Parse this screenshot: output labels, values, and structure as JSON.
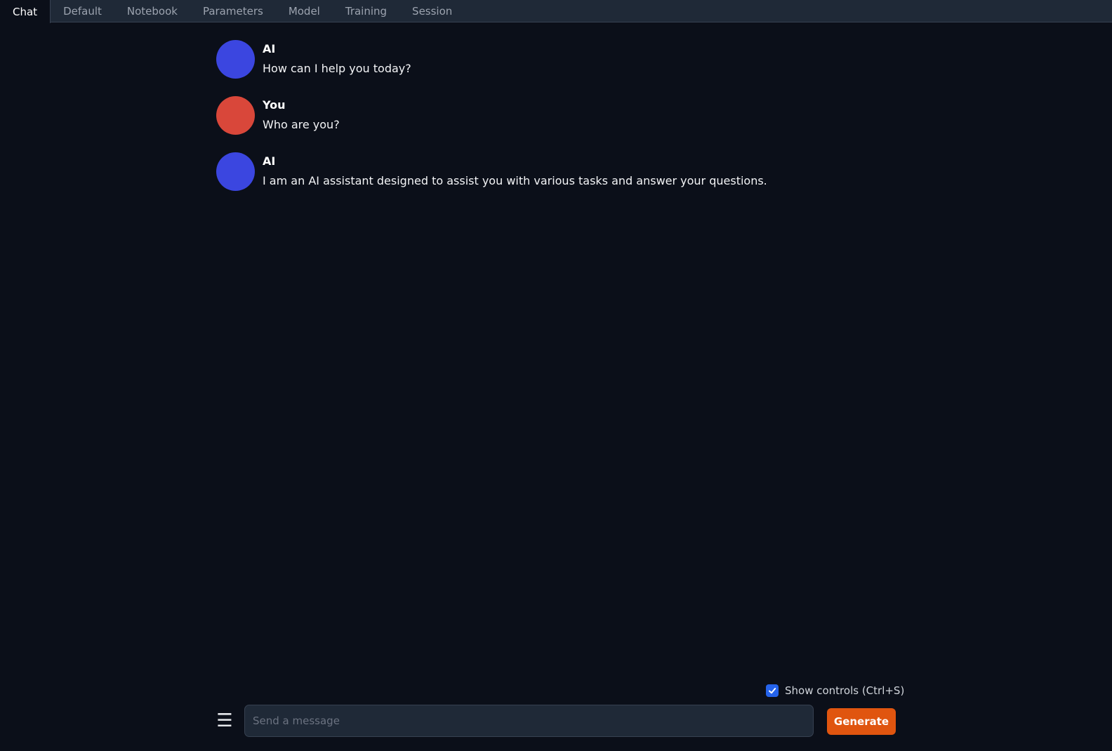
{
  "tabs": [
    {
      "label": "Chat",
      "active": true
    },
    {
      "label": "Default",
      "active": false
    },
    {
      "label": "Notebook",
      "active": false
    },
    {
      "label": "Parameters",
      "active": false
    },
    {
      "label": "Model",
      "active": false
    },
    {
      "label": "Training",
      "active": false
    },
    {
      "label": "Session",
      "active": false
    }
  ],
  "messages": [
    {
      "sender": "AI",
      "text": "How can I help you today?",
      "avatar_color": "#3b46e0"
    },
    {
      "sender": "You",
      "text": "Who are you?",
      "avatar_color": "#d9473a"
    },
    {
      "sender": "AI",
      "text": "I am an AI assistant designed to assist you with various tasks and answer your questions.",
      "avatar_color": "#3b46e0"
    }
  ],
  "controls": {
    "show_controls_label": "Show controls (Ctrl+S)",
    "show_controls_checked": true
  },
  "input": {
    "placeholder": "Send a message",
    "value": ""
  },
  "generate_label": "Generate",
  "colors": {
    "background": "#0b0f19",
    "tabbar": "#1f2937",
    "accent": "#e0550f",
    "checkbox": "#2563eb"
  },
  "icons": {
    "menu": "hamburger-menu-icon",
    "check": "checkmark-icon"
  }
}
